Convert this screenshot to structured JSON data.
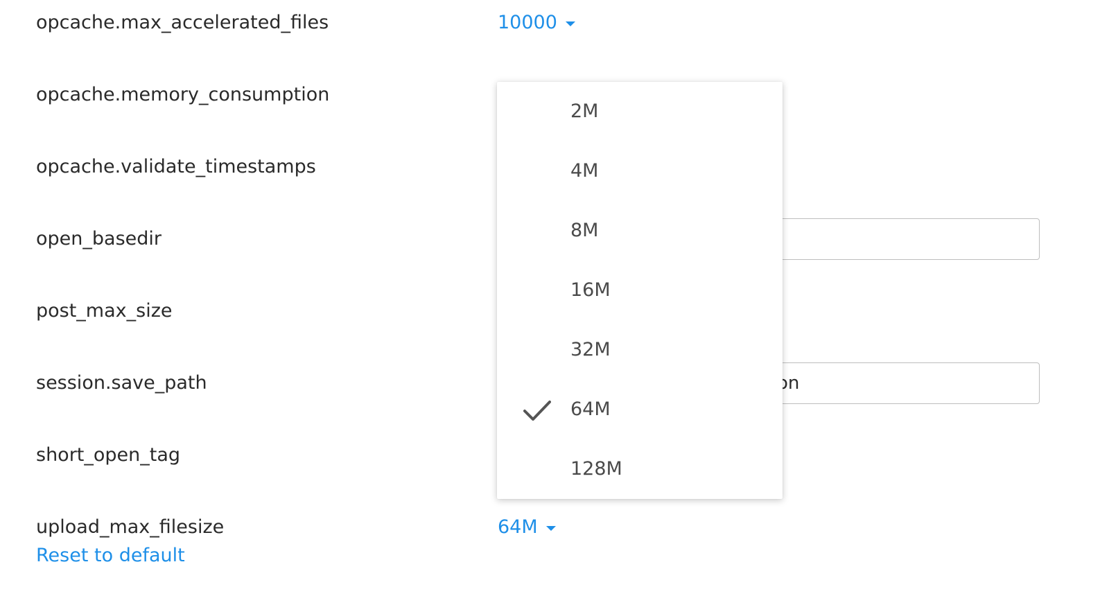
{
  "settings": {
    "rows": [
      {
        "label": "opcache.max_accelerated_files"
      },
      {
        "label": "opcache.memory_consumption"
      },
      {
        "label": "opcache.validate_timestamps"
      },
      {
        "label": "open_basedir"
      },
      {
        "label": "post_max_size"
      },
      {
        "label": "session.save_path"
      },
      {
        "label": "short_open_tag"
      },
      {
        "label": "upload_max_filesize"
      }
    ],
    "max_accelerated_files_value": "10000",
    "open_basedir_value": "",
    "session_save_path_visible_value": "on",
    "upload_max_filesize_value": "64M",
    "reset_label": "Reset to default"
  },
  "dropdown": {
    "options": [
      {
        "label": "2M"
      },
      {
        "label": "4M"
      },
      {
        "label": "8M"
      },
      {
        "label": "16M"
      },
      {
        "label": "32M"
      },
      {
        "label": "64M"
      },
      {
        "label": "128M"
      }
    ],
    "selected": "64M"
  },
  "icons": {
    "dropdown_caret": "chevron-down-icon",
    "selected_check": "check-icon"
  },
  "colors": {
    "link": "#1e8fe8",
    "label_text": "#2a2a2a",
    "option_text": "#4a4a4a",
    "input_border": "#bdbdbd"
  }
}
